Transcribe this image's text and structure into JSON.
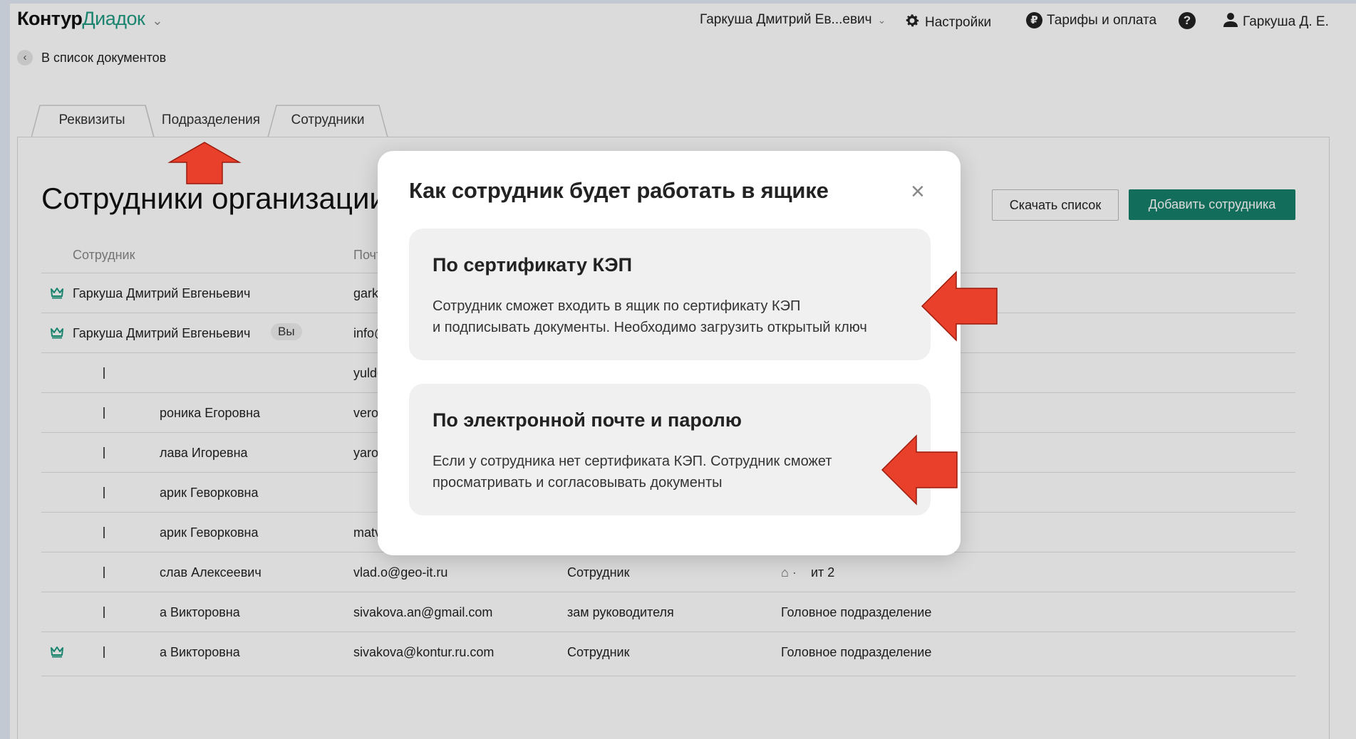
{
  "header": {
    "logo_part1": "Контур",
    "logo_part2": "Диадок",
    "org_selector": "Гаркуша Дмитрий Ев...евич",
    "settings": "Настройки",
    "tariffs": "Тарифы и оплата",
    "help": "?",
    "user": "Гаркуша Д. Е."
  },
  "back_link": "В список документов",
  "tabs": [
    "Реквизиты",
    "Подразделения",
    "Сотрудники"
  ],
  "page_title": "Сотрудники организации",
  "actions": {
    "download": "Скачать список",
    "add": "Добавить сотрудника"
  },
  "table": {
    "headers": [
      "Сотрудник",
      "Почта"
    ],
    "rows": [
      {
        "name": "Гаркуша Дмитрий Евгеньевич",
        "email": "garku",
        "role": "",
        "department": "",
        "admin": true,
        "you": ""
      },
      {
        "name": "Гаркуша Дмитрий Евгеньевич",
        "email": "info@",
        "role": "",
        "department": "",
        "admin": true,
        "you": "Вы"
      },
      {
        "name": "",
        "email": "yuldo",
        "role": "",
        "department": "",
        "admin": false,
        "you": ""
      },
      {
        "name": "роника Егоровна",
        "email": "veron",
        "role": "",
        "department": "",
        "admin": false,
        "you": ""
      },
      {
        "name": "лава Игоревна",
        "email": "yaros",
        "role": "",
        "department": "",
        "admin": false,
        "you": ""
      },
      {
        "name": "арик Геворковна",
        "email": "",
        "role": "",
        "department": "",
        "admin": false,
        "you": ""
      },
      {
        "name": "арик Геворковна",
        "email": "matvi",
        "role": "",
        "department": "",
        "admin": false,
        "you": ""
      },
      {
        "name": "слав Алексеевич",
        "email": "vlad.o@geo-it.ru",
        "role": "Сотрудник",
        "department": "ит 2",
        "admin": false,
        "you": ""
      },
      {
        "name": "а Викторовна",
        "email": "sivakova.an@gmail.com",
        "role": "зам руководителя",
        "department": "Головное подразделение",
        "admin": false,
        "you": ""
      },
      {
        "name": "а Викторовна",
        "email": "sivakova@kontur.ru.com",
        "role": "Сотрудник",
        "department": "Головное подразделение",
        "admin": true,
        "you": ""
      }
    ]
  },
  "modal": {
    "title": "Как сотрудник будет работать в ящике",
    "close": "×",
    "options": [
      {
        "title": "По сертификату КЭП",
        "desc_line1": "Сотрудник сможет входить в ящик по сертификату КЭП",
        "desc_line2": "и подписывать документы. Необходимо загрузить открытый ключ"
      },
      {
        "title": "По электронной почте и паролю",
        "desc_line1": "Если у сотрудника нет сертификата КЭП. Сотрудник сможет",
        "desc_line2": "просматривать и согласовывать документы"
      }
    ]
  },
  "colors": {
    "brand": "#1f9a82",
    "primary_button": "#157f6b",
    "arrow": "#e8402a",
    "crown": "#1f9a82"
  }
}
